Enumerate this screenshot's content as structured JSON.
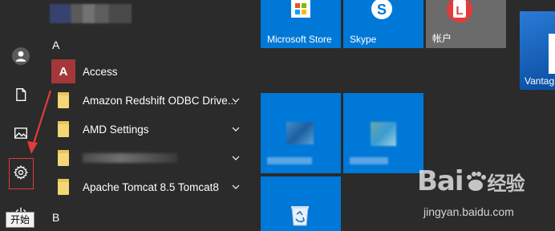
{
  "sidebar": {
    "tooltip": "开始"
  },
  "app_list": {
    "letters": [
      "A",
      "B"
    ],
    "items": [
      {
        "label": "Access"
      },
      {
        "label": "Amazon Redshift ODBC Drive..."
      },
      {
        "label": "AMD Settings"
      },
      {
        "label": ""
      },
      {
        "label": "Apache Tomcat 8.5 Tomcat8"
      }
    ]
  },
  "tiles": {
    "store_label": "Microsoft Store",
    "skype_label": "Skype",
    "account_label": "帐户",
    "vantage_label": "Vantag"
  },
  "watermark": {
    "brand": "Bai",
    "brand_suffix": "经验",
    "url": "jingyan.baidu.com"
  },
  "colors": {
    "accent": "#0078d7",
    "highlight_red": "#e23b3b",
    "folder_yellow": "#f4d774",
    "access_red": "#a4373a"
  }
}
